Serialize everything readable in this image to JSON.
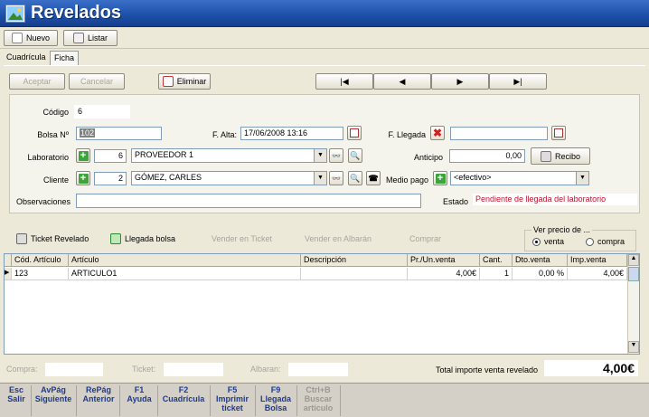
{
  "window": {
    "title": "Revelados"
  },
  "toolbar": {
    "nuevo": "Nuevo",
    "listar": "Listar"
  },
  "tabs": [
    {
      "label": "Cuadrícula"
    },
    {
      "label": "Ficha"
    }
  ],
  "actions": {
    "aceptar": "Aceptar",
    "cancelar": "Cancelar",
    "eliminar": "Eliminar",
    "nav": [
      "|◀",
      "◀",
      "▶",
      "▶|"
    ]
  },
  "form": {
    "codigo": {
      "label": "Código",
      "value": "6"
    },
    "bolsa": {
      "label": "Bolsa Nº",
      "value": "102"
    },
    "falta": {
      "label": "F. Alta:",
      "value": "17/06/2008 13:16"
    },
    "fllegada": {
      "label": "F. Llegada",
      "value": ""
    },
    "laboratorio": {
      "label": "Laboratorio",
      "code": "6",
      "name": "PROVEEDOR 1"
    },
    "anticipo": {
      "label": "Anticipo",
      "value": "0,00"
    },
    "recibo": "Recibo",
    "cliente": {
      "label": "Cliente",
      "code": "2",
      "name": "GÓMEZ, CARLES"
    },
    "medio_pago": {
      "label": "Medio pago",
      "value": "<efectivo>"
    },
    "observaciones": {
      "label": "Observaciones",
      "value": ""
    },
    "estado": {
      "label": "Estado",
      "value": "Pendiente de llegada del laboratorio"
    }
  },
  "secondary": {
    "ticket_revelado": "Ticket Revelado",
    "llegada_bolsa": "Llegada bolsa",
    "vender_ticket": "Vender en Ticket",
    "vender_albaran": "Vender en Albarán",
    "comprar": "Comprar",
    "ver_precio": {
      "title": "Ver precio de ...",
      "venta": "venta",
      "compra": "compra",
      "selected": "venta"
    }
  },
  "grid": {
    "columns": [
      "Cód. Artículo",
      "Artículo",
      "Descripción",
      "Pr./Un.venta",
      "Cant.",
      "Dto.venta",
      "Imp.venta"
    ],
    "rows": [
      [
        "123",
        "ARTICULO1",
        "",
        "4,00€",
        "1",
        "0,00 %",
        "4,00€"
      ]
    ]
  },
  "footer": {
    "compra": "Compra:",
    "ticket": "Ticket:",
    "albaran": "Albaran:",
    "total_label": "Total importe venta revelado",
    "total_value": "4,00€"
  },
  "fkeys": [
    {
      "key": "Esc",
      "label": "Salir",
      "enabled": true
    },
    {
      "key": "AvPág",
      "label": "Siguiente",
      "enabled": true
    },
    {
      "key": "RePág",
      "label": "Anterior",
      "enabled": true
    },
    {
      "key": "F1",
      "label": "Ayuda",
      "enabled": true
    },
    {
      "key": "F2",
      "label": "Cuadrícula",
      "enabled": true
    },
    {
      "key": "F5",
      "label": "Imprimir ticket",
      "enabled": true
    },
    {
      "key": "F9",
      "label": "Llegada Bolsa",
      "enabled": true
    },
    {
      "key": "Ctrl+B",
      "label": "Buscar artículo",
      "enabled": false
    }
  ]
}
